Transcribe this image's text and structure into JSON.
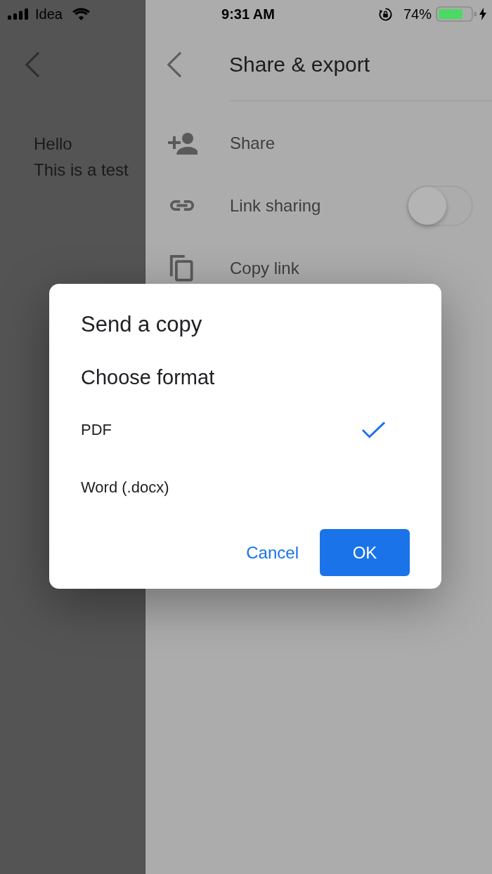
{
  "status_bar": {
    "carrier": "Idea",
    "time": "9:31 AM",
    "battery": "74%"
  },
  "document": {
    "lines": [
      "Hello",
      "This is a test"
    ]
  },
  "share_panel": {
    "title": "Share & export",
    "items": [
      {
        "kind": "action",
        "label": "Share"
      },
      {
        "kind": "toggle",
        "label": "Link sharing",
        "on": false
      },
      {
        "kind": "action",
        "label": "Copy link"
      }
    ]
  },
  "dialog": {
    "title": "Send a copy",
    "subtitle": "Choose format",
    "options": [
      {
        "label": "PDF",
        "selected": true
      },
      {
        "label": "Word (.docx)",
        "selected": false
      }
    ],
    "buttons": [
      {
        "kind": "text",
        "label": "Cancel"
      },
      {
        "kind": "primary",
        "label": "OK"
      }
    ]
  }
}
